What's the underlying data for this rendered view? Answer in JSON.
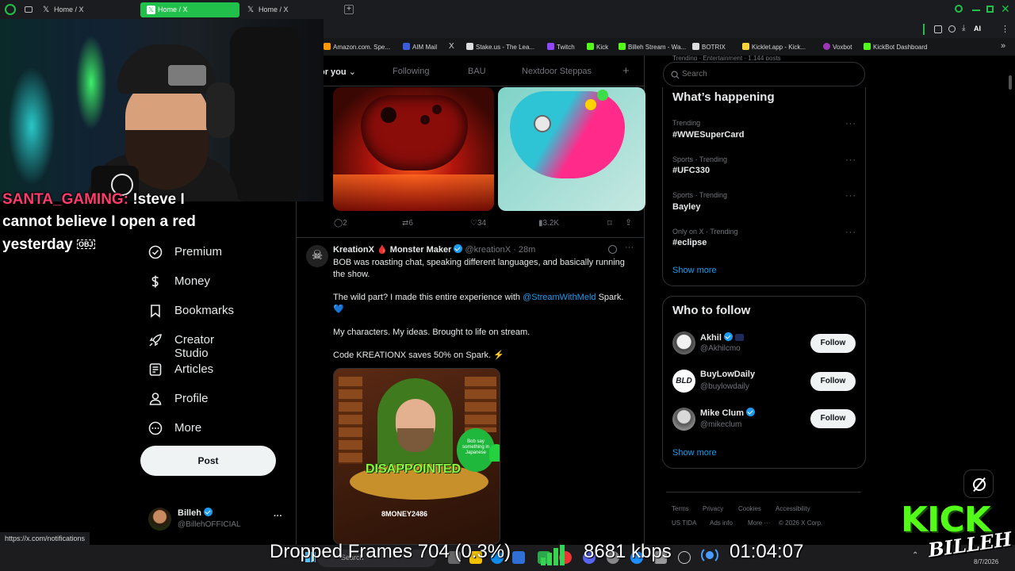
{
  "browser": {
    "tabs": [
      {
        "label": "Home / X"
      },
      {
        "label": "Home / X"
      },
      {
        "label": "Home / X"
      }
    ],
    "ai_label": "AI",
    "bookmarks": [
      {
        "label": "Amazon.com. Spe...",
        "color": "#ff9900"
      },
      {
        "label": "AIM Mail",
        "color": "#3b5bdb"
      },
      {
        "label": "X",
        "color": "#000000"
      },
      {
        "label": "Stake.us - The Lea...",
        "color": "#ffffff"
      },
      {
        "label": "Twitch",
        "color": "#9146ff"
      },
      {
        "label": "Kick",
        "color": "#53fc18"
      },
      {
        "label": "Billeh Stream - Wa...",
        "color": "#53fc18"
      },
      {
        "label": "BOTRIX",
        "color": "#ffffff"
      },
      {
        "label": "Kicklet.app - Kick...",
        "color": "#ffd43b"
      },
      {
        "label": "Voxbot",
        "color": "#9c36b5"
      },
      {
        "label": "KickBot Dashboard",
        "color": "#53fc18"
      }
    ],
    "status_url": "https://x.com/notifications"
  },
  "feed_tabs": [
    "or you",
    "Following",
    "BAU",
    "Nextdoor Steppas",
    "+"
  ],
  "tweet1_actions": {
    "replies": "2",
    "reposts": "6",
    "likes": "34",
    "views": "3.2K"
  },
  "tweet2": {
    "author": "KreationX",
    "drop": "🩸",
    "author_suffix": "Monster Maker",
    "handle": "@kreationX",
    "time": "· 28m",
    "p1": "BOB was roasting chat, speaking different languages, and basically running the show.",
    "p2_a": "The wild part? I made this entire experience with ",
    "p2_link": "@StreamWithMeld",
    "p2_b": " Spark.",
    "p2_heart": "💙",
    "p3": "My characters. My ideas. Brought to life on stream.",
    "p4": "Code KREATIONX saves 50% on Spark. ⚡",
    "image_caption": "DISAPPOINTED",
    "image_bubble": "Bob say something in Japanese",
    "image_user": "8MONEY2486"
  },
  "nav": {
    "items": [
      {
        "label": "Premium",
        "icon": "x-logo-icon"
      },
      {
        "label": "Money",
        "icon": "money-icon"
      },
      {
        "label": "Bookmarks",
        "icon": "bookmark-icon"
      },
      {
        "label": "Creator Studio",
        "icon": "rocket-icon"
      },
      {
        "label": "Articles",
        "icon": "article-icon"
      },
      {
        "label": "Profile",
        "icon": "person-icon"
      },
      {
        "label": "More",
        "icon": "more-circle-icon"
      }
    ],
    "post_label": "Post",
    "account_name": "Billeh",
    "account_handle": "@BillehOFFICIAL",
    "more_dots": "···"
  },
  "sidebar": {
    "search_placeholder": "Search",
    "top_cut_text": "Trending · Entertainment · 1,144 posts",
    "whats_happening_title": "What’s happening",
    "trends": [
      {
        "meta": "Trending",
        "name": "#WWESuperCard"
      },
      {
        "meta": "Sports · Trending",
        "name": "#UFC330"
      },
      {
        "meta": "Sports · Trending",
        "name": "Bayley"
      },
      {
        "meta": "Only on X · Trending",
        "name": "#eclipse"
      }
    ],
    "show_more": "Show more",
    "who_to_follow_title": "Who to follow",
    "follow_suggestions": [
      {
        "name": "Akhil",
        "handle": "@Akhilcmo",
        "button": "Follow"
      },
      {
        "name": "BuyLowDaily",
        "handle": "@buylowdaily",
        "button": "Follow"
      },
      {
        "name": "Mike Clum",
        "handle": "@mikeclum",
        "button": "Follow"
      }
    ],
    "show_more_2": "Show more",
    "footer_row1": [
      "Terms",
      "Privacy",
      "Cookies",
      "Accessibility"
    ],
    "footer_row2": [
      "US TIDA",
      "Ads info",
      "More ···",
      "© 2026 X Corp."
    ]
  },
  "overlay": {
    "chat_user": "SANTA_GAMING:",
    "chat_text_1": "!steve I",
    "chat_text_2": "cannot believe I open a red",
    "chat_text_3": "yesterday",
    "chat_obj": "OBJ",
    "dropped_frames": "Dropped Frames 704 (0.3%)",
    "bitrate": "8681 kbps",
    "uptime": "01:04:07",
    "brand_kick": "KICK",
    "brand_name": "BILLEH",
    "taskbar_search": "Search",
    "taskbar_date": "8/7/2026"
  },
  "colors": {
    "accent": "#1d9bf0",
    "kick_green": "#53fc18",
    "tab_green": "#21c04a"
  }
}
